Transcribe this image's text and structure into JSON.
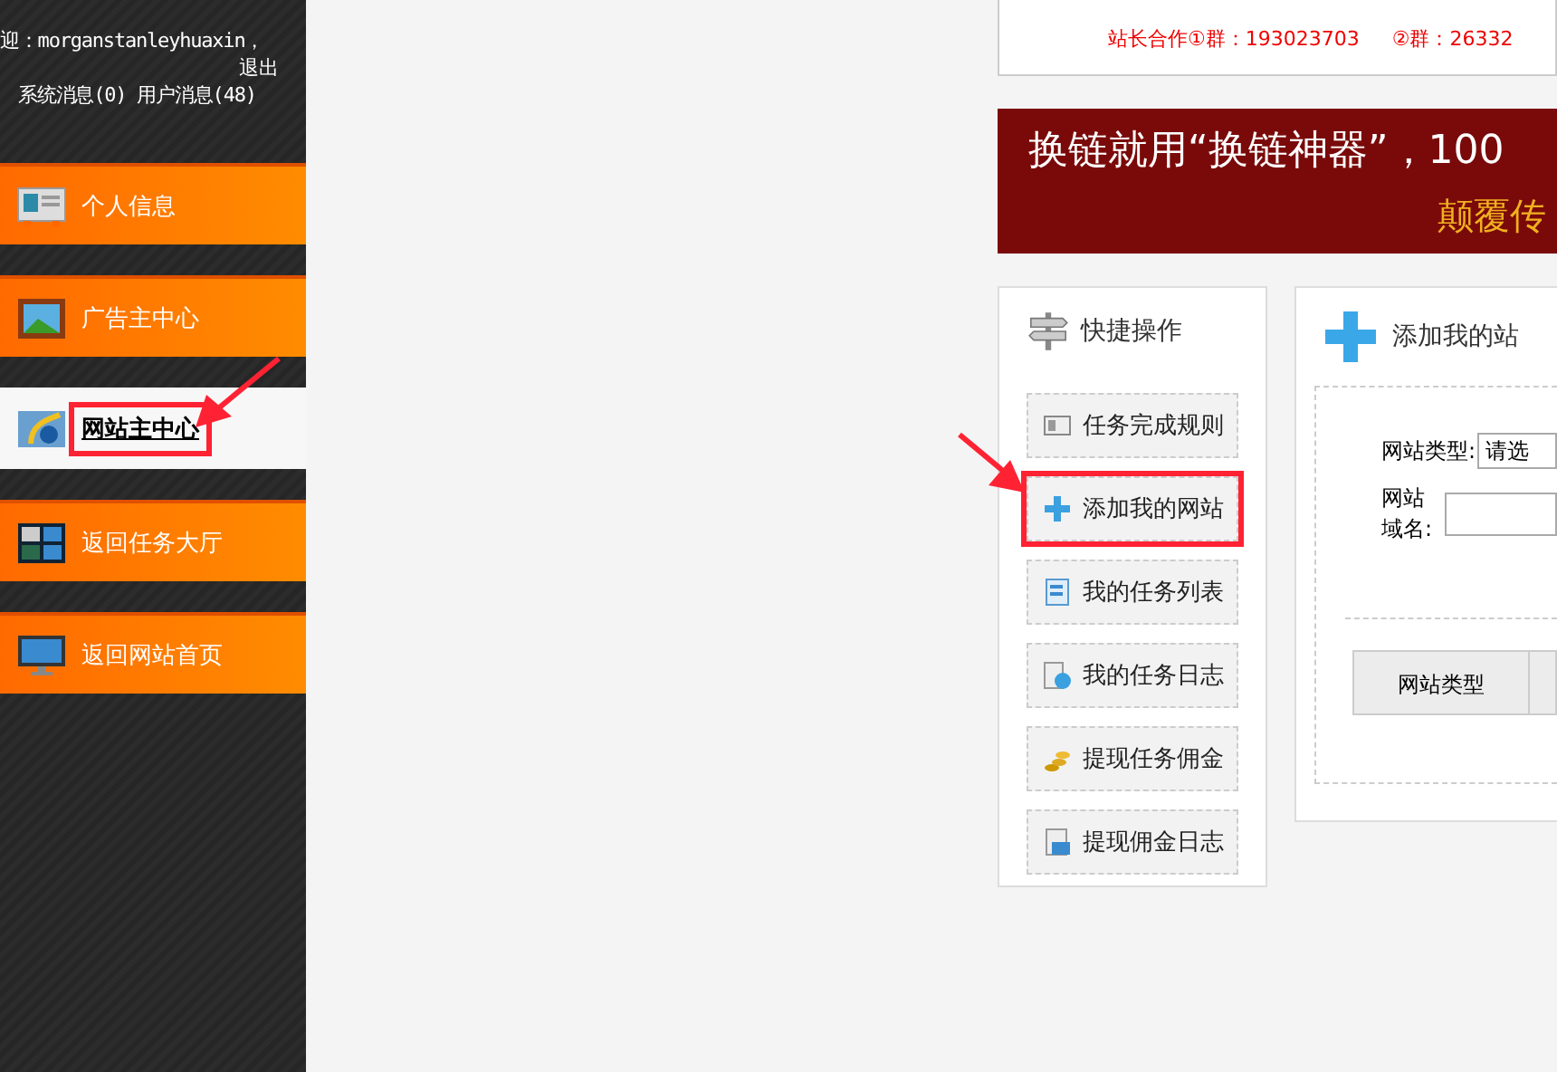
{
  "sidebar": {
    "welcome": "迎：morganstanleyhuaxin，",
    "logout": "退出",
    "messages": "系统消息(0) 用户消息(48)",
    "items": [
      {
        "label": "个人信息",
        "selected": false,
        "highlighted": false
      },
      {
        "label": "广告主中心",
        "selected": false,
        "highlighted": false
      },
      {
        "label": "网站主中心",
        "selected": true,
        "highlighted": true
      },
      {
        "label": "返回任务大厅",
        "selected": false,
        "highlighted": false
      },
      {
        "label": "返回网站首页",
        "selected": false,
        "highlighted": false
      }
    ]
  },
  "info_box": {
    "groups": "站长合作①群：193023703",
    "groups_2": "②群：26332"
  },
  "banner": {
    "headline": "换链就用“换链神器”，100",
    "subline": "颠覆传"
  },
  "quick_actions": {
    "title": "快捷操作",
    "items": [
      {
        "label": "任务完成规则",
        "highlighted": false
      },
      {
        "label": "添加我的网站",
        "highlighted": true
      },
      {
        "label": "我的任务列表",
        "highlighted": false
      },
      {
        "label": "我的任务日志",
        "highlighted": false
      },
      {
        "label": "提现任务佣金",
        "highlighted": false
      },
      {
        "label": "提现佣金日志",
        "highlighted": false
      }
    ]
  },
  "add_site": {
    "title": "添加我的站",
    "type_label": "网站类型:",
    "type_value": "请选",
    "domain_label": "网站域名:",
    "columns": [
      "网站类型"
    ]
  }
}
